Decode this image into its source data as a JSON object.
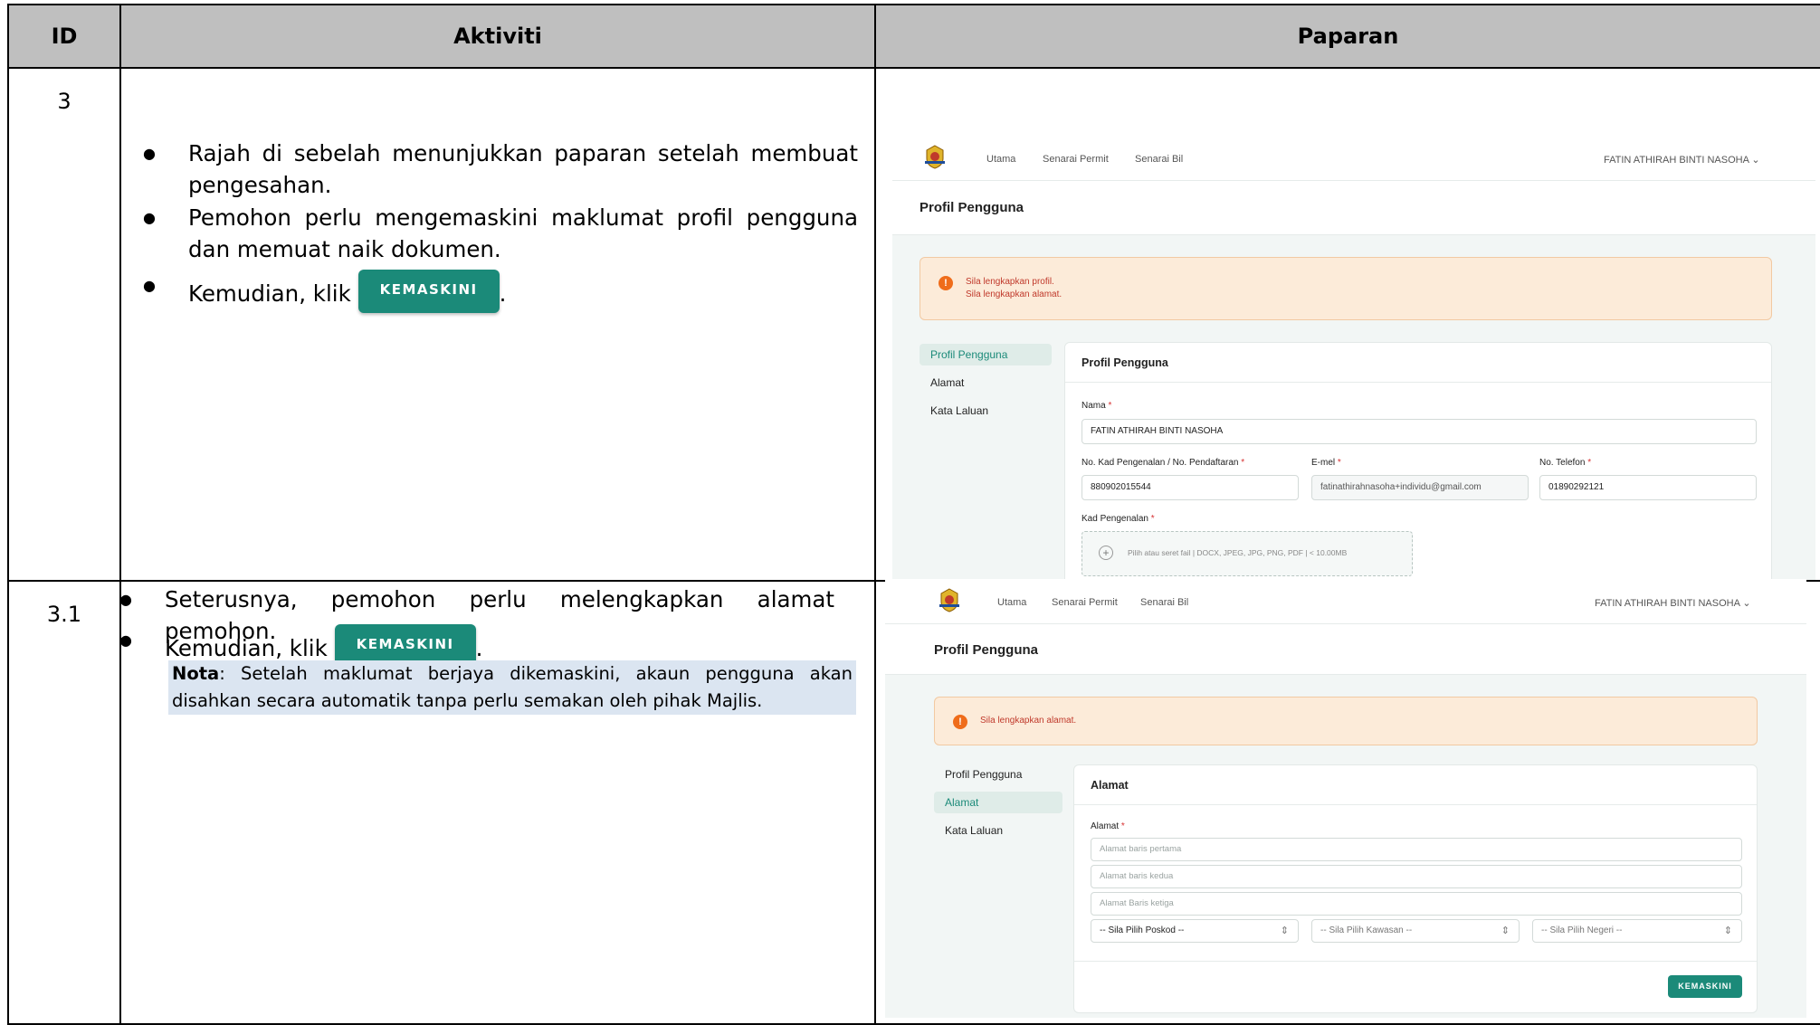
{
  "table": {
    "headers": {
      "id": "ID",
      "aktiviti": "Aktiviti",
      "paparan": "Paparan"
    }
  },
  "rows": [
    {
      "id": "3",
      "bullets": [
        "Rajah di sebelah menunjukkan paparan setelah membuat pengesahan.",
        "Pemohon perlu mengemaskini maklumat profil pengguna dan memuat naik dokumen.",
        "Kemudian, klik"
      ],
      "bullet_end": ".",
      "inline_button": "KEMASKINI"
    },
    {
      "id": "3.1",
      "bullets": [
        "Seterusnya, pemohon perlu melengkapkan alamat pemohon.",
        "Kemudian, klik"
      ],
      "bullet_end": ".",
      "inline_button": "KEMASKINI",
      "nota_label": "Nota",
      "nota_text": ": Setelah maklumat berjaya dikemaskini, akaun pengguna akan disahkan secara automatik tanpa perlu semakan oleh pihak Majlis."
    }
  ],
  "screens": {
    "nav": [
      "Utama",
      "Senarai Permit",
      "Senarai Bil"
    ],
    "user": "FATIN ATHIRAH BINTI NASOHA",
    "page_title": "Profil Pengguna",
    "side_menu": [
      "Profil Pengguna",
      "Alamat",
      "Kata Laluan"
    ],
    "button": "KEMASKINI",
    "profile": {
      "alerts": [
        "Sila lengkapkan profil.",
        "Sila lengkapkan alamat."
      ],
      "card_title": "Profil Pengguna",
      "nama_label": "Nama",
      "nama_value": "FATIN ATHIRAH BINTI NASOHA",
      "ic_label": "No. Kad Pengenalan / No. Pendaftaran",
      "ic_value": "880902015544",
      "email_label": "E-mel",
      "email_value": "fatinathirahnasoha+individu@gmail.com",
      "phone_label": "No. Telefon",
      "phone_value": "01890292121",
      "kad_label": "Kad Pengenalan",
      "upload_hint": "Pilih atau seret fail | DOCX, JPEG, JPG, PNG, PDF | < 10.00MB",
      "required_mark": "*"
    },
    "alamat": {
      "alert": "Sila lengkapkan alamat.",
      "card_title": "Alamat",
      "alamat_label": "Alamat",
      "placeholders": [
        "Alamat baris pertama",
        "Alamat baris kedua",
        "Alamat Baris ketiga"
      ],
      "selects": [
        "-- Sila Pilih Poskod --",
        "-- Sila Pilih Kawasan --",
        "-- Sila Pilih Negeri --"
      ]
    }
  },
  "colors": {
    "accent": "#1b8a79",
    "alert_bg": "#fcebd9",
    "alert_text": "#c0392b",
    "header_bg": "#bfbfbf",
    "nota_bg": "#dbe5f1"
  },
  "icons": [
    "crest-logo",
    "chevron-down-icon",
    "alert-circle-icon",
    "plus-circle-icon",
    "select-arrows-icon"
  ]
}
